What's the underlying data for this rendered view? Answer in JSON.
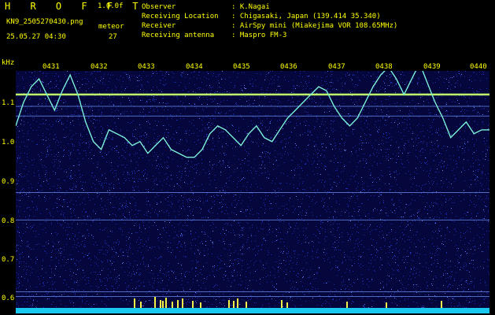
{
  "header": {
    "title": "H R O F F T",
    "version": "1.0.0f",
    "filename": "KN9_2505270430.png",
    "datetime": "25.05.27 04:30",
    "meteor_label": "meteor",
    "meteor_count": "27",
    "info": [
      {
        "key": "Observer",
        "value": ": K.Nagai"
      },
      {
        "key": "Receiving Location",
        "value": ": Chigasaki, Japan (139.414 35.340)"
      },
      {
        "key": "Receiver",
        "value": ": AirSpy mini (Miakejima VOR 108.65MHz)"
      },
      {
        "key": "Receiving antenna",
        "value": ": Maspro FM-3"
      }
    ]
  },
  "axes": {
    "y_unit": "kHz",
    "y_ticks": [
      "1.1",
      "1.0",
      "0.9",
      "0.8",
      "0.7",
      "0.6"
    ],
    "x_ticks": [
      "0431",
      "0432",
      "0433",
      "0434",
      "0435",
      "0436",
      "0437",
      "0438",
      "0439",
      "0440"
    ]
  },
  "colors": {
    "background": "#05063b",
    "noise": "#1b2fb0",
    "trace": "#7cf0d8",
    "carrier": "#bff56a",
    "text": "#ffff00",
    "floor": "#19c8f0",
    "meteor": "#f2f24a"
  },
  "spectrogram": {
    "carrier_khz": 1.12,
    "horizontal_lines_khz": [
      1.09,
      1.065,
      0.87,
      0.8,
      0.617,
      0.605
    ],
    "trace_khz": [
      1.04,
      1.1,
      1.14,
      1.16,
      1.12,
      1.08,
      1.13,
      1.17,
      1.12,
      1.05,
      1.0,
      0.98,
      1.03,
      1.02,
      1.01,
      0.99,
      1.0,
      0.97,
      0.99,
      1.01,
      0.98,
      0.97,
      0.96,
      0.96,
      0.98,
      1.02,
      1.04,
      1.03,
      1.01,
      0.99,
      1.02,
      1.04,
      1.01,
      1.0,
      1.03,
      1.06,
      1.08,
      1.1,
      1.12,
      1.14,
      1.13,
      1.09,
      1.06,
      1.04,
      1.06,
      1.1,
      1.14,
      1.17,
      1.19,
      1.16,
      1.12,
      1.16,
      1.2,
      1.15,
      1.1,
      1.06,
      1.01,
      1.03,
      1.05,
      1.02,
      1.03,
      1.03
    ]
  }
}
